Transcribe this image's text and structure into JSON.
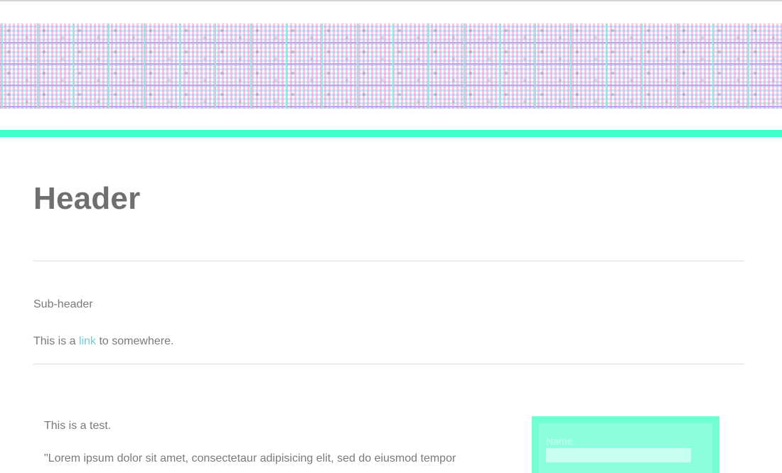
{
  "header": {
    "title": "Header"
  },
  "content": {
    "subheader": "Sub-header",
    "link_sentence": {
      "before": "This is a ",
      "link_text": "link",
      "after": " to somewhere."
    },
    "test_text": "This is a test.",
    "lorem_text": "\"Lorem ipsum dolor sit amet, consectetaur adipisicing elit, sed do eiusmod tempor"
  },
  "form": {
    "name_label": "Name",
    "name_value": ""
  },
  "colors": {
    "accent": "#3fffc8",
    "panel": "#73ffd1",
    "link": "#75cbd6",
    "text": "#7a7a7a"
  }
}
